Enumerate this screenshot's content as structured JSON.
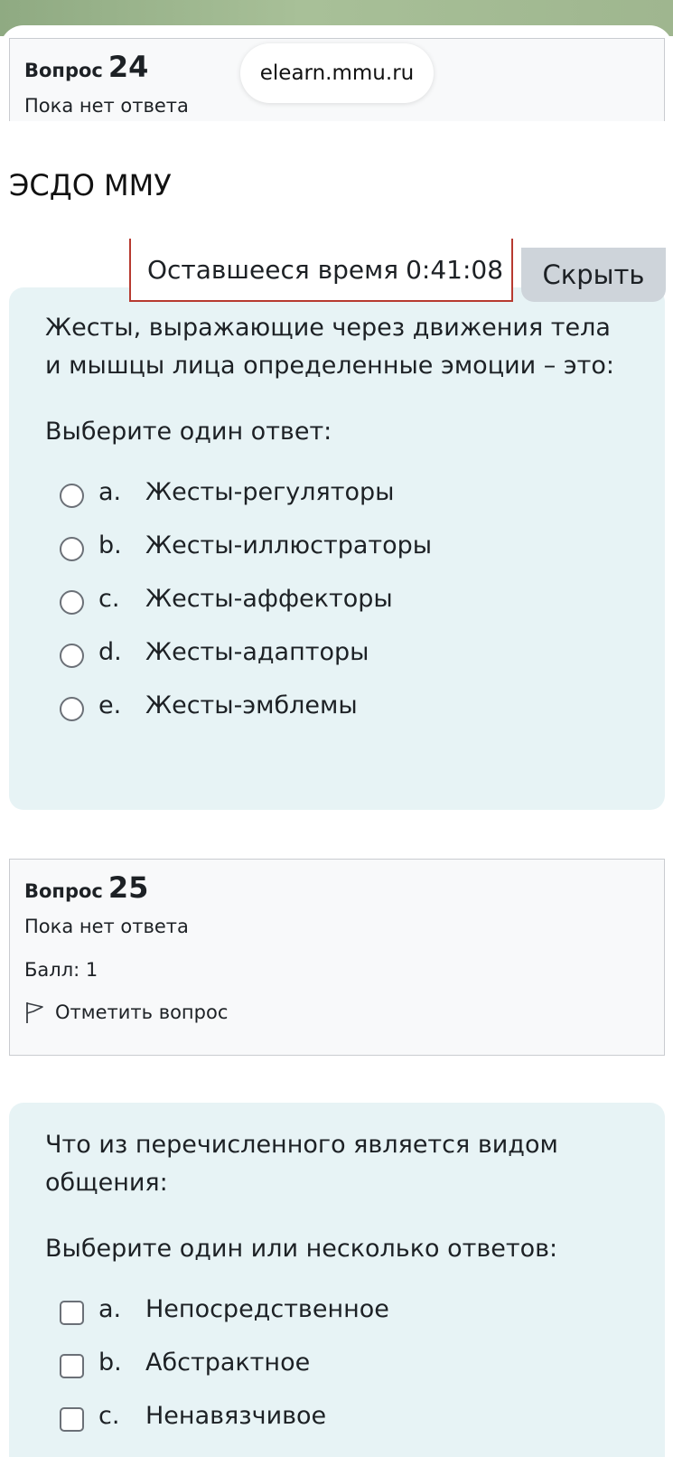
{
  "browser": {
    "url": "elearn.mmu.ru"
  },
  "site": {
    "title": "ЭСДО ММУ"
  },
  "timer": {
    "label": "Оставшееся время",
    "value": "0:41:08",
    "hide_label": "Скрыть"
  },
  "questions": [
    {
      "label": "Вопрос",
      "number": "24",
      "state": "Пока нет ответа",
      "text": "Жесты, выражающие через движения тела и мышцы лица определенные эмоции – это:",
      "prompt": "Выберите один ответ:",
      "answers": [
        {
          "letter": "a.",
          "text": "Жесты-регуляторы"
        },
        {
          "letter": "b.",
          "text": "Жесты-иллюстраторы"
        },
        {
          "letter": "c.",
          "text": "Жесты-аффекторы"
        },
        {
          "letter": "d.",
          "text": "Жесты-адапторы"
        },
        {
          "letter": "e.",
          "text": "Жесты-эмблемы"
        }
      ]
    },
    {
      "label": "Вопрос",
      "number": "25",
      "state": "Пока нет ответа",
      "grade": "Балл: 1",
      "flag": "Отметить вопрос",
      "text": "Что из перечисленного является видом общения:",
      "prompt": "Выберите один или несколько ответов:",
      "answers": [
        {
          "letter": "a.",
          "text": "Непосредственное"
        },
        {
          "letter": "b.",
          "text": "Абстрактное"
        },
        {
          "letter": "c.",
          "text": "Ненавязчивое"
        }
      ]
    }
  ]
}
